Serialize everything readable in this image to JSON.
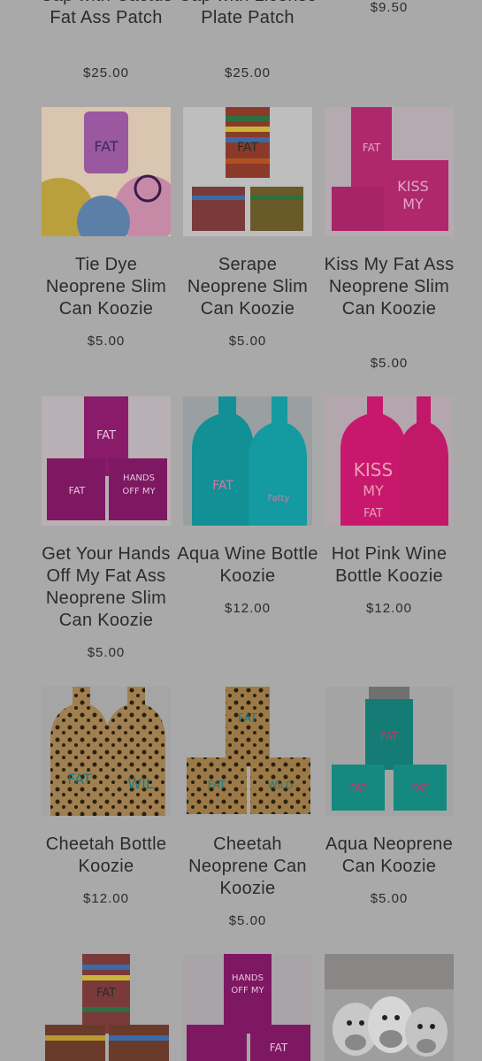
{
  "row0": [
    {
      "title_tail": "Cap with Cactus Fat Ass Patch",
      "price": "$25.00"
    },
    {
      "title_tail": "Cap with License Plate Patch",
      "price": "$25.00"
    },
    {
      "title_tail": "",
      "price": "$9.50"
    }
  ],
  "products": [
    {
      "title": "Tie Dye Neoprene Slim Can Koozie",
      "price": "$5.00",
      "image": "tie-dye-koozie"
    },
    {
      "title": "Serape Neoprene Slim Can Koozie",
      "price": "$5.00",
      "image": "serape-koozie"
    },
    {
      "title": "Kiss My Fat Ass Neoprene Slim Can Koozie",
      "price": "$5.00",
      "image": "kiss-my-koozie"
    },
    {
      "title": "Get Your Hands Off My Fat Ass Neoprene Slim Can Koozie",
      "price": "$5.00",
      "image": "hands-off-koozie"
    },
    {
      "title": "Aqua Wine Bottle Koozie",
      "price": "$12.00",
      "image": "aqua-wine-koozie"
    },
    {
      "title": "Hot Pink Wine Bottle Koozie",
      "price": "$12.00",
      "image": "hot-pink-wine-koozie"
    },
    {
      "title": "Cheetah Bottle Koozie",
      "price": "$12.00",
      "image": "cheetah-bottle-koozie"
    },
    {
      "title": "Cheetah Neoprene Can Koozie",
      "price": "$5.00",
      "image": "cheetah-can-koozie"
    },
    {
      "title": "Aqua Neoprene Can Koozie",
      "price": "$5.00",
      "image": "aqua-can-koozie"
    },
    {
      "title": "",
      "price": "",
      "image": "serape-can-koozie"
    },
    {
      "title": "",
      "price": "",
      "image": "purple-can-koozie"
    },
    {
      "title": "",
      "price": "",
      "image": "donkey-plush"
    }
  ],
  "colors": {
    "background": "#a9a9a9",
    "text": "#2b2b2b",
    "pink": "#d0217a",
    "aqua": "#139aa0",
    "purple": "#8a1a6a"
  }
}
